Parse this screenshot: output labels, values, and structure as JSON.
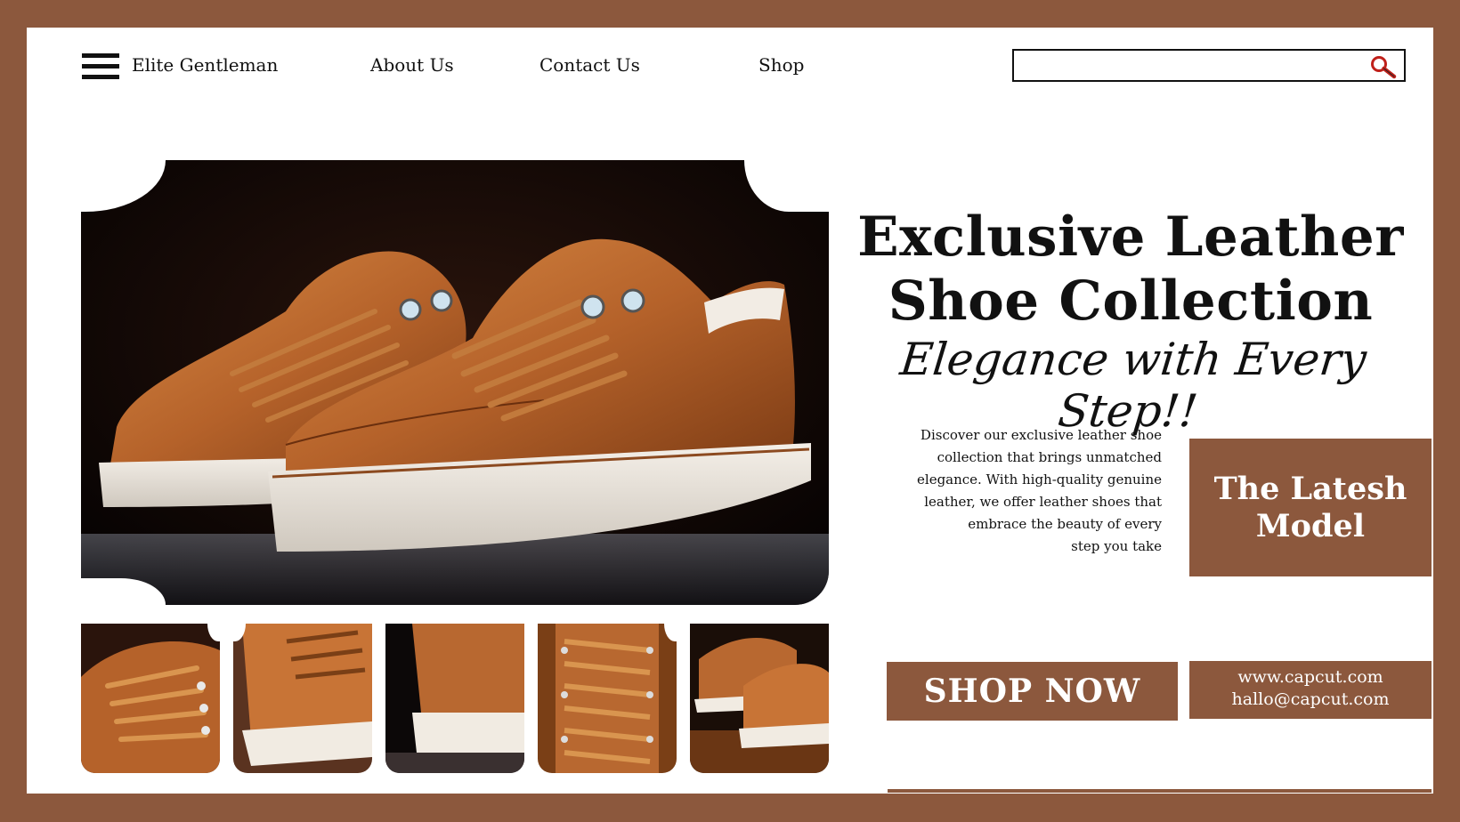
{
  "nav": {
    "brand": "Elite Gentleman",
    "links": [
      "About Us",
      "Contact Us",
      "Shop"
    ],
    "search_placeholder": ""
  },
  "hero": {
    "headline_line1": "Exclusive Leather",
    "headline_line2": "Shoe Collection",
    "tagline": "Elegance with Every Step!!",
    "description_lines": [
      "Discover our exclusive leather shoe",
      "collection that brings unmatched",
      "elegance. With high-quality genuine",
      "leather, we offer leather shoes that",
      "embrace the beauty of every",
      "step you take"
    ],
    "latest_line1": "The Latesh",
    "latest_line2": "Model"
  },
  "cta": {
    "shop_now": "SHOP NOW",
    "website": "www.capcut.com",
    "email": "hallo@capcut.com"
  },
  "thumbnails": [
    "shoe-laces-closeup",
    "shoe-side-view",
    "shoe-heel-view",
    "shoe-top-laces",
    "shoe-pair-floor"
  ],
  "colors": {
    "accent": "#8c583d",
    "leather": "#b5622a",
    "background": "#ffffff",
    "text": "#111111"
  }
}
